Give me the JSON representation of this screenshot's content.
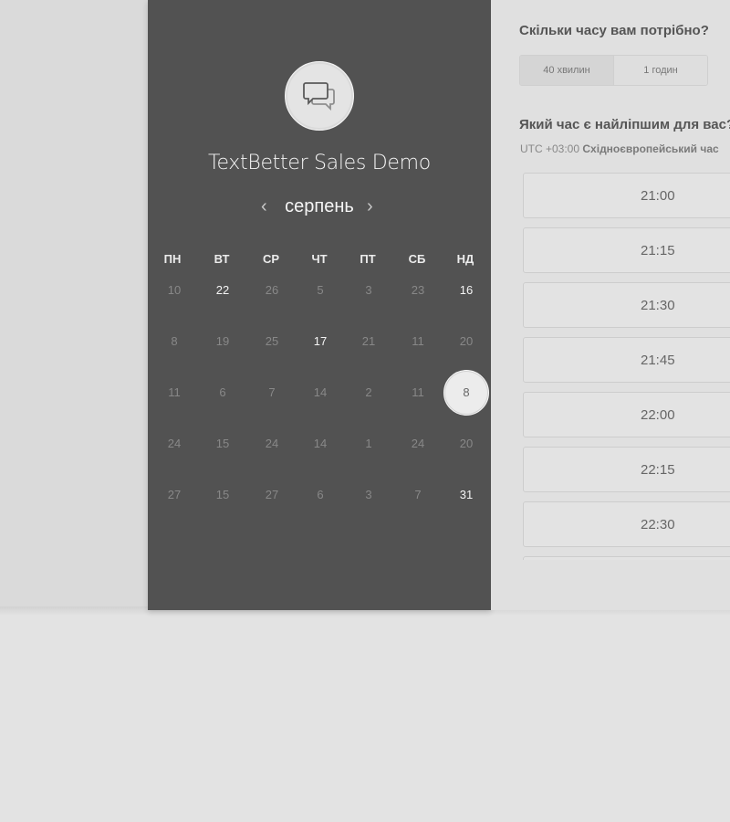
{
  "event": {
    "title": "TextBetter Sales Demo",
    "avatar_icon": "chat-bubbles-icon"
  },
  "calendar": {
    "month": "серпень",
    "prev_icon": "chevron-left-icon",
    "next_icon": "chevron-right-icon",
    "prev_glyph": "‹",
    "next_glyph": "›",
    "weekdays": [
      "ПН",
      "ВТ",
      "СР",
      "ЧТ",
      "ПТ",
      "СБ",
      "НД"
    ],
    "weeks": [
      [
        "10",
        "22",
        "26",
        "5",
        "3",
        "23",
        "16"
      ],
      [
        "8",
        "19",
        "25",
        "17",
        "21",
        "11",
        "20"
      ],
      [
        "11",
        "6",
        "7",
        "14",
        "2",
        "11",
        "8"
      ],
      [
        "24",
        "15",
        "24",
        "14",
        "1",
        "24",
        "20"
      ],
      [
        "27",
        "15",
        "27",
        "6",
        "3",
        "7",
        "31"
      ]
    ],
    "available": [
      [
        0,
        1
      ],
      [
        0,
        6
      ],
      [
        1,
        3
      ],
      [
        4,
        6
      ]
    ],
    "selected": [
      2,
      6
    ]
  },
  "duration": {
    "question": "Скільки часу вам потрібно?",
    "options": [
      "40 хвилин",
      "1 годин"
    ],
    "selected_index": 0
  },
  "time": {
    "question": "Який час є найліпшим для вас?",
    "timezone_offset": "UTC +03:00",
    "timezone_name": "Східноєвропейський час",
    "slots": [
      "21:00",
      "21:15",
      "21:30",
      "21:45",
      "22:00",
      "22:15",
      "22:30",
      ""
    ]
  }
}
